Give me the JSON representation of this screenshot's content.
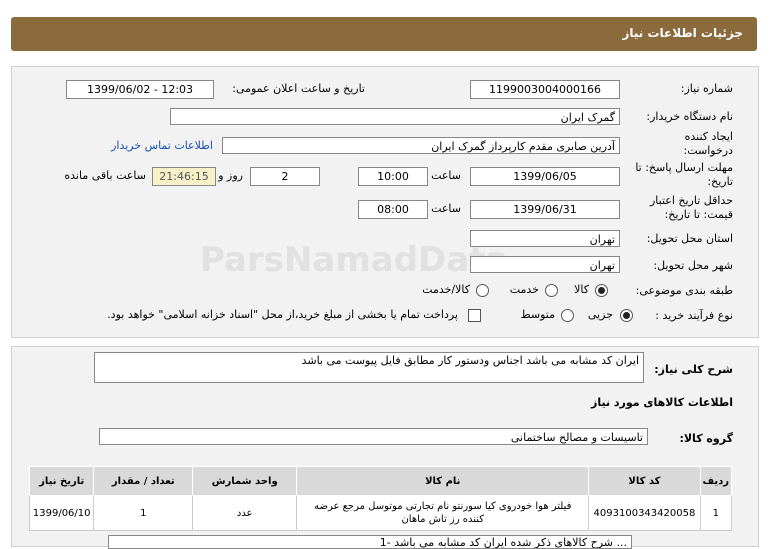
{
  "header": {
    "title": "جزئیات اطلاعات نیاز"
  },
  "form": {
    "need_number_label": "شماره نیاز:",
    "need_number": "1199003004000166",
    "announce_label": "تاریخ و ساعت اعلان عمومی:",
    "announce_value": "1399/06/02 - 12:03",
    "buyer_label": "نام دستگاه خریدار:",
    "buyer_value": "گمرک ایران",
    "creator_label": "ایجاد کننده درخواست:",
    "creator_value": "آدرین صابری مقدم کارپرداز گمرک ایران",
    "contact_link": "اطلاعات تماس خریدار",
    "deadline_label": "مهلت ارسال پاسخ: تا تاریخ:",
    "deadline_date": "1399/06/05",
    "time_label": "ساعت",
    "deadline_time": "10:00",
    "days_value": "2",
    "days_label": "روز و",
    "remaining_time": "21:46:15",
    "remaining_label": "ساعت باقی مانده",
    "validity_label": "حداقل تاریخ اعتبار قیمت: تا تاریخ:",
    "validity_date": "1399/06/31",
    "validity_time": "08:00",
    "province_label": "استان محل تحویل:",
    "province_value": "تهران",
    "city_label": "شهر محل تحویل:",
    "city_value": "تهران",
    "category_label": "طبقه بندی موضوعی:",
    "category_options": [
      "کالا",
      "خدمت",
      "کالا/خدمت"
    ],
    "purchase_label": "نوع فرآیند خرید :",
    "purchase_options": [
      "جزیی",
      "متوسط"
    ],
    "payment_note": "پرداخت تمام یا بخشی از مبلغ خرید،از محل \"اسناد خزانه اسلامی\" خواهد بود."
  },
  "details": {
    "summary_label": "شرح کلی نیاز:",
    "summary_value": "ایران کد مشابه می باشد اجناس ودستور کار مطابق فایل پیوست می باشد",
    "goods_info_title": "اطلاعات کالاهای مورد نیاز",
    "group_label": "گروه کالا:",
    "group_value": "تاسیسات و مصالح ساختمانی"
  },
  "table": {
    "headers": [
      "ردیف",
      "کد کالا",
      "نام کالا",
      "واحد شمارش",
      "تعداد / مقدار",
      "تاریخ نیاز"
    ],
    "rows": [
      [
        "1",
        "4093100343420058",
        "فیلتر هوا خودروی کیا سورنتو نام تجارتی موتوسل مرجع عرضه کننده رز تاش ماهان",
        "عدد",
        "1",
        "1399/06/10"
      ]
    ]
  },
  "footer_note": "1- شرح کالاهای ذکر شده ایران کد مشابه می باشد ..."
}
